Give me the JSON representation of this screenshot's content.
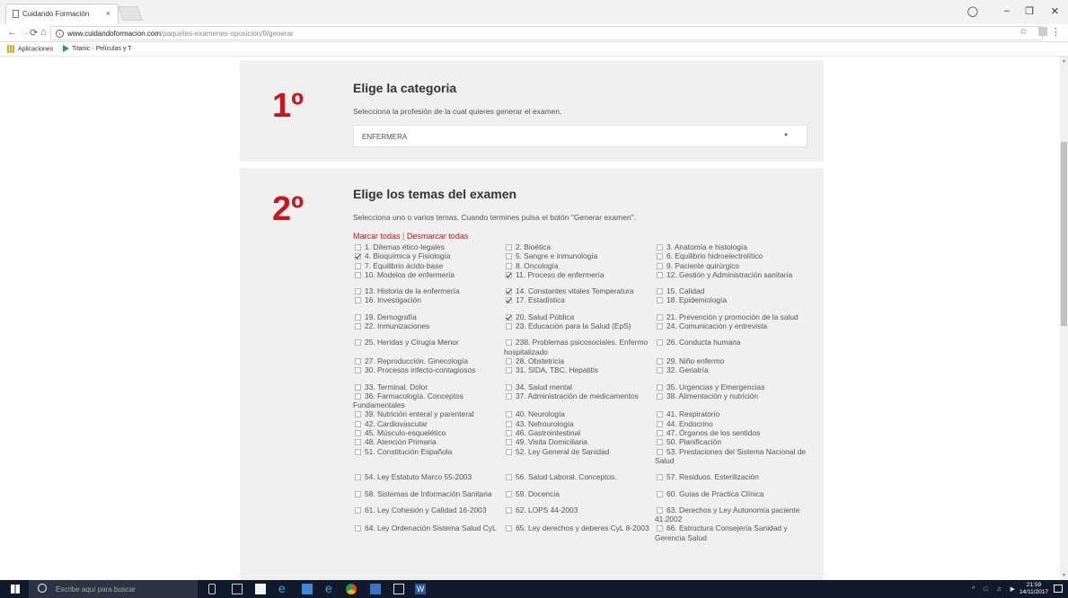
{
  "browser": {
    "tab_title": "Cuidando Formación",
    "tab_close": "×",
    "url_domain": "www.cuidandoformacion.com",
    "url_path": "/paquetes-examenes-oposicion/9/generar",
    "bookmarks": [
      "Aplicaciones",
      "Titanic - Películas y T"
    ]
  },
  "step1": {
    "number": "1º",
    "title": "Elige la categoria",
    "description": "Selecciona la profesión de la cual quieres generar el examen.",
    "selected": "ENFERMERA"
  },
  "step2": {
    "number": "2º",
    "title": "Elige los temas del examen",
    "description": "Selecciona uno o varios temas. Cuando termines pulsa el botón \"Generar examen\".",
    "select_all": "Marcar todas",
    "separator": "|",
    "deselect_all": "Desmarcar todas",
    "temas": [
      {
        "label": "1. Dilemas ético-legales",
        "checked": false
      },
      {
        "label": "2. Bioética",
        "checked": false
      },
      {
        "label": "3. Anatomía e histología",
        "checked": false
      },
      {
        "label": "4. Bioquímica y Fisiología",
        "checked": true
      },
      {
        "label": "5. Sangre e inmunología",
        "checked": false
      },
      {
        "label": "6. Equilibrio hidroelectrolítico",
        "checked": false
      },
      {
        "label": "7. Equilibrio ácido-base",
        "checked": false
      },
      {
        "label": "8. Oncología",
        "checked": false
      },
      {
        "label": "9. Paciente quirúrgico",
        "checked": false
      },
      {
        "label": "10. Modelos de enfermería",
        "checked": false
      },
      {
        "label": "11. Proceso de enfermería",
        "checked": true
      },
      {
        "label": "12. Gestión y Administración sanitaria",
        "checked": false
      },
      {
        "label": "13. Historia de la enfermería",
        "checked": false
      },
      {
        "label": "14. Constantes vitales Temperatura",
        "checked": true
      },
      {
        "label": "15. Calidad",
        "checked": false
      },
      {
        "label": "16. Investigación",
        "checked": false
      },
      {
        "label": "17. Estadística",
        "checked": true
      },
      {
        "label": "18. Epidemiología",
        "checked": false
      },
      {
        "label": "19. Demografía",
        "checked": false
      },
      {
        "label": "20. Salud Pública",
        "checked": true
      },
      {
        "label": "21. Prevención y promoción de la salud",
        "checked": false
      },
      {
        "label": "22. Inmunizaciones",
        "checked": false
      },
      {
        "label": "23. Educación para la Salud (EpS)",
        "checked": false
      },
      {
        "label": "24. Comunicación y entrevista",
        "checked": false
      },
      {
        "label": "25. Heridas y Cirugía Menor",
        "checked": false
      },
      {
        "label": "238. Problemas psicosociales. Enfermo hospitalizado",
        "checked": false
      },
      {
        "label": "26. Conducta humana",
        "checked": false
      },
      {
        "label": "27. Reproducción. Ginecología",
        "checked": false
      },
      {
        "label": "28. Obstetricia",
        "checked": false
      },
      {
        "label": "29. Niño enfermo",
        "checked": false
      },
      {
        "label": "30. Procesos infecto-contagiosos",
        "checked": false
      },
      {
        "label": "31. SIDA, TBC, Hepatitis",
        "checked": false
      },
      {
        "label": "32. Geriatría",
        "checked": false
      },
      {
        "label": "33. Terminal. Dolor",
        "checked": false
      },
      {
        "label": "34. Salud mental",
        "checked": false
      },
      {
        "label": "35. Urgencias y Emergencias",
        "checked": false
      },
      {
        "label": "36. Farmacología. Conceptos Fundamentales",
        "checked": false
      },
      {
        "label": "37. Administración de medicamentos",
        "checked": false
      },
      {
        "label": "38. Alimentación y nutrición",
        "checked": false
      },
      {
        "label": "39. Nutrición enteral y parenteral",
        "checked": false
      },
      {
        "label": "40. Neurología",
        "checked": false
      },
      {
        "label": "41. Respiratorio",
        "checked": false
      },
      {
        "label": "42. Cardiovascular",
        "checked": false
      },
      {
        "label": "43. Nefrourología",
        "checked": false
      },
      {
        "label": "44. Endocrino",
        "checked": false
      },
      {
        "label": "45. Músculo-esquelético",
        "checked": false
      },
      {
        "label": "46. Gastrointestinal",
        "checked": false
      },
      {
        "label": "47. Órganos de los sentidos",
        "checked": false
      },
      {
        "label": "48. Atención Primaria",
        "checked": false
      },
      {
        "label": "49. Visita Domiciliaria",
        "checked": false
      },
      {
        "label": "50. Planificación",
        "checked": false
      },
      {
        "label": "51. Constitución Española",
        "checked": false
      },
      {
        "label": "52. Ley General de Sanidad",
        "checked": false
      },
      {
        "label": "53. Prestaciones del Sistema Nacional de Salud",
        "checked": false
      },
      {
        "label": "54. Ley Estatuto Marco 55-2003",
        "checked": false
      },
      {
        "label": "56. Salud Laboral. Conceptos.",
        "checked": false
      },
      {
        "label": "57. Residuos. Esterilización",
        "checked": false
      },
      {
        "label": "58. Sistemas de Información Sanitaria",
        "checked": false
      },
      {
        "label": "59. Docencia",
        "checked": false
      },
      {
        "label": "60. Guías de Practica Clínica",
        "checked": false
      },
      {
        "label": "61. Ley Cohesión y Calidad 16-2003",
        "checked": false
      },
      {
        "label": "62. LOPS 44-2003",
        "checked": false
      },
      {
        "label": "63. Derechos y Ley Autonomía paciente 41.2002",
        "checked": false
      },
      {
        "label": "64. Ley Ordenación Sistema Salud CyL",
        "checked": false
      },
      {
        "label": "65. Ley derechos y deberes CyL 8-2003",
        "checked": false
      },
      {
        "label": "66. Estructura Consejería Sanidad y Gerencia Salud",
        "checked": false
      }
    ]
  },
  "taskbar": {
    "search_placeholder": "Escribe aquí para buscar",
    "time": "21:59",
    "date": "14/11/2017"
  },
  "colors": {
    "accent": "#c8161d",
    "panel": "#f0f0f0",
    "taskbar": "#101a2a"
  }
}
